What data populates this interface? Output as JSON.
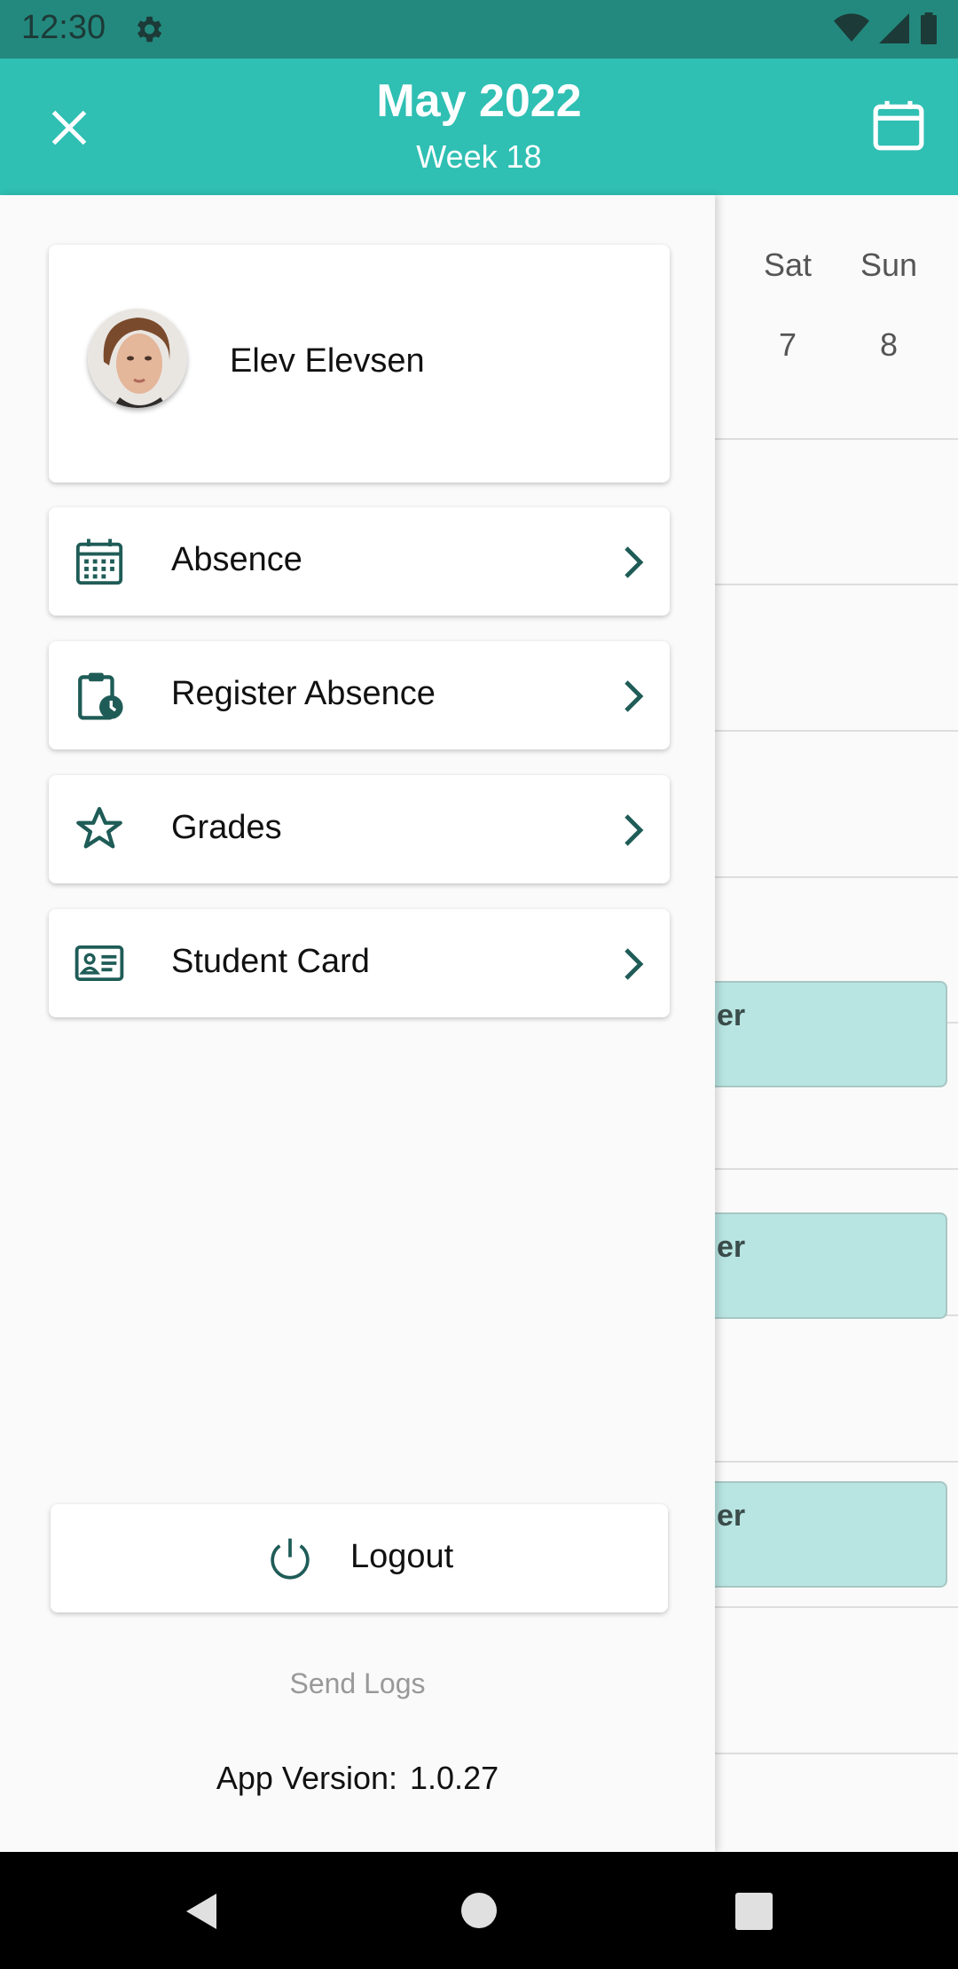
{
  "status_bar": {
    "time": "12:30"
  },
  "header": {
    "title": "May 2022",
    "subtitle": "Week 18"
  },
  "calendar": {
    "days": [
      {
        "name": "Sat",
        "date": "7"
      },
      {
        "name": "Sun",
        "date": "8"
      }
    ],
    "events": [
      {
        "text": "er"
      },
      {
        "text": "er"
      },
      {
        "text": "er"
      }
    ]
  },
  "profile": {
    "name": "Elev Elevsen"
  },
  "menu": {
    "items": [
      {
        "label": "Absence",
        "icon": "calendar-grid-icon"
      },
      {
        "label": "Register Absence",
        "icon": "clipboard-clock-icon"
      },
      {
        "label": "Grades",
        "icon": "star-icon"
      },
      {
        "label": "Student Card",
        "icon": "id-card-icon"
      }
    ]
  },
  "footer": {
    "logout_label": "Logout",
    "send_logs_label": "Send Logs",
    "version_label": "App Version:",
    "version_value": "1.0.27"
  },
  "colors": {
    "primary": "#2fbfb3",
    "status_bar": "#23897e",
    "icon": "#1f5c57",
    "event": "#b8e5e2"
  }
}
